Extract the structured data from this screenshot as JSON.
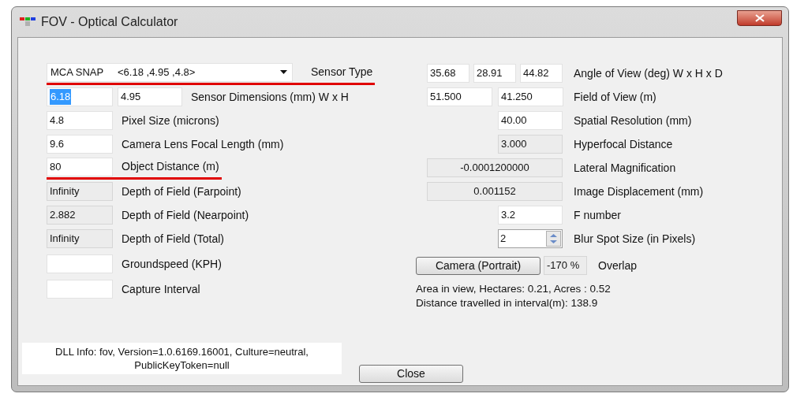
{
  "window": {
    "title": "FOV - Optical Calculator"
  },
  "sensor_type": {
    "value": "MCA SNAP     <6.18 ,4.95 ,4.8>",
    "label": "Sensor Type",
    "underlined": true
  },
  "left_rows": [
    {
      "label": "Sensor Dimensions (mm) W x H",
      "underlined": false,
      "fields": [
        {
          "value": "6.18",
          "readonly": false,
          "highlighted": true
        },
        {
          "value": "4.95",
          "readonly": false,
          "highlighted": false
        }
      ]
    },
    {
      "label": "Pixel Size (microns)",
      "underlined": false,
      "fields": [
        {
          "value": "4.8",
          "readonly": false,
          "highlighted": false
        }
      ]
    },
    {
      "label": "Camera Lens Focal Length (mm)",
      "underlined": false,
      "fields": [
        {
          "value": "9.6",
          "readonly": false,
          "highlighted": false
        }
      ]
    },
    {
      "label": "Object Distance (m)",
      "underlined": true,
      "fields": [
        {
          "value": "80",
          "readonly": false,
          "highlighted": false
        }
      ]
    },
    {
      "label": "Depth of Field (Farpoint)",
      "underlined": false,
      "fields": [
        {
          "value": "Infinity",
          "readonly": true,
          "highlighted": false
        }
      ]
    },
    {
      "label": "Depth of Field (Nearpoint)",
      "underlined": false,
      "fields": [
        {
          "value": "2.882",
          "readonly": true,
          "highlighted": false
        }
      ]
    },
    {
      "label": "Depth of Field (Total)",
      "underlined": false,
      "fields": [
        {
          "value": "Infinity",
          "readonly": true,
          "highlighted": false
        }
      ]
    },
    {
      "label": "Groundspeed (KPH)",
      "underlined": false,
      "fields": [
        {
          "readonly": false
        }
      ]
    },
    {
      "label": "Capture Interval",
      "underlined": false,
      "fields": [
        {
          "readonly": false
        }
      ]
    }
  ],
  "right_rows": [
    {
      "kind": "triple",
      "label": "Angle of View (deg) W x H x D",
      "fields": [
        {
          "value": "35.68",
          "readonly": false
        },
        {
          "value": "28.91",
          "readonly": false
        },
        {
          "value": "44.82",
          "readonly": false
        }
      ]
    },
    {
      "kind": "pair",
      "label": "Field of View (m)",
      "fields": [
        {
          "value": "51.500",
          "readonly": false
        },
        {
          "value": "41.250",
          "readonly": false
        }
      ]
    },
    {
      "kind": "single",
      "label": "Spatial Resolution (mm)",
      "fields": [
        {
          "value": "40.00",
          "readonly": false
        }
      ]
    },
    {
      "kind": "single",
      "label": "Hyperfocal Distance",
      "fields": [
        {
          "value": "3.000",
          "readonly": true
        }
      ]
    },
    {
      "kind": "wide",
      "label": "Lateral Magnification",
      "fields": [
        {
          "value": "-0.0001200000",
          "readonly": true
        }
      ]
    },
    {
      "kind": "wide",
      "label": "Image Displacement (mm)",
      "fields": [
        {
          "value": "0.001152",
          "readonly": true
        }
      ]
    },
    {
      "kind": "single",
      "label": "F number",
      "fields": [
        {
          "value": "3.2",
          "readonly": false
        }
      ]
    },
    {
      "kind": "spinner",
      "label": "Blur Spot Size (in Pixels)",
      "fields": [
        {
          "value": "2",
          "readonly": false
        }
      ]
    }
  ],
  "camera_button": "Camera (Portrait)",
  "overlap": {
    "value": "-170 %",
    "readonly": true,
    "label": "Overlap"
  },
  "info_lines": [
    "Area in view, Hectares: 0.21, Acres : 0.52",
    "Distance travelled in interval(m): 138.9"
  ],
  "dll_info": "DLL Info: fov, Version=1.0.6169.16001, Culture=neutral, PublicKeyToken=null",
  "close_button": "Close"
}
